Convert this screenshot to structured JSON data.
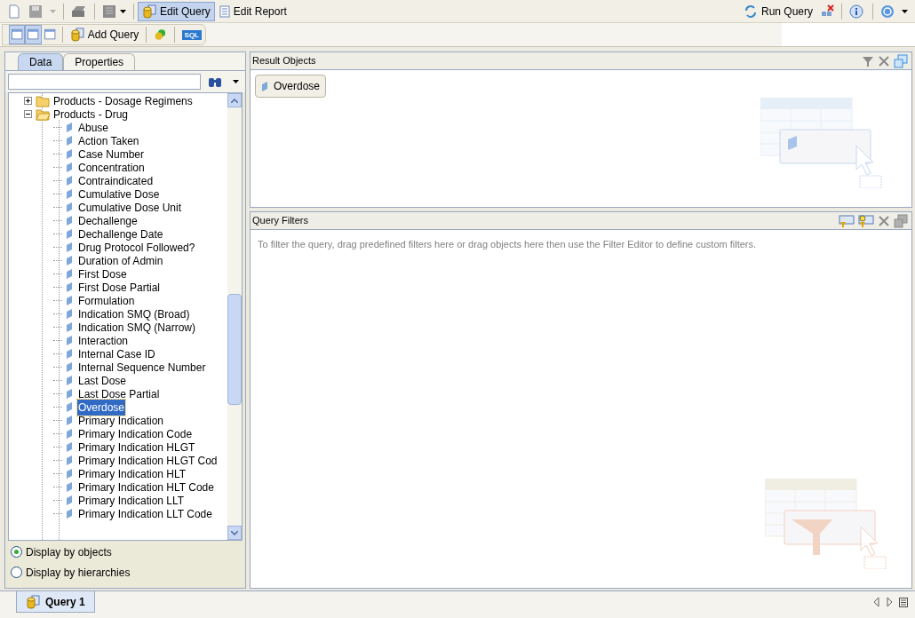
{
  "toolbar": {
    "buttons": [
      {
        "label": "Edit Query",
        "selected": true
      },
      {
        "label": "Edit Report",
        "selected": false
      }
    ],
    "run_query": "Run Query"
  },
  "query_toolbar": {
    "views": [
      {
        "selected": true
      },
      {
        "selected": true
      },
      {
        "selected": false
      }
    ],
    "add_query": "Add Query",
    "sql": "SQL"
  },
  "left_panel": {
    "tabs": [
      {
        "label": "Data",
        "selected": true
      },
      {
        "label": "Properties",
        "selected": false
      }
    ],
    "tree": [
      {
        "label": "Products - Dosage Regimens",
        "expanded": false
      },
      {
        "label": "Products - Drug",
        "expanded": true,
        "children": [
          {
            "label": "Abuse",
            "selected": false
          },
          {
            "label": "Action Taken",
            "selected": false
          },
          {
            "label": "Case Number",
            "selected": false
          },
          {
            "label": "Concentration",
            "selected": false
          },
          {
            "label": "Contraindicated",
            "selected": false
          },
          {
            "label": "Cumulative Dose",
            "selected": false
          },
          {
            "label": "Cumulative Dose Unit",
            "selected": false
          },
          {
            "label": "Dechallenge",
            "selected": false
          },
          {
            "label": "Dechallenge Date",
            "selected": false
          },
          {
            "label": "Drug Protocol Followed?",
            "selected": false
          },
          {
            "label": "Duration of Admin",
            "selected": false
          },
          {
            "label": "First Dose",
            "selected": false
          },
          {
            "label": "First Dose Partial",
            "selected": false
          },
          {
            "label": "Formulation",
            "selected": false
          },
          {
            "label": "Indication SMQ (Broad)",
            "selected": false
          },
          {
            "label": "Indication SMQ (Narrow)",
            "selected": false
          },
          {
            "label": "Interaction",
            "selected": false
          },
          {
            "label": "Internal Case ID",
            "selected": false
          },
          {
            "label": "Internal Sequence Number",
            "selected": false
          },
          {
            "label": "Last Dose",
            "selected": false
          },
          {
            "label": "Last Dose Partial",
            "selected": false
          },
          {
            "label": "Overdose",
            "selected": true
          },
          {
            "label": "Primary Indication",
            "selected": false
          },
          {
            "label": "Primary Indication Code",
            "selected": false
          },
          {
            "label": "Primary Indication HLGT",
            "selected": false
          },
          {
            "label": "Primary Indication HLGT Cod",
            "selected": false
          },
          {
            "label": "Primary Indication HLT",
            "selected": false
          },
          {
            "label": "Primary Indication HLT Code",
            "selected": false
          },
          {
            "label": "Primary Indication LLT",
            "selected": false
          },
          {
            "label": "Primary Indication LLT Code",
            "selected": false
          }
        ]
      }
    ],
    "display_options": [
      {
        "label": "Display by objects",
        "selected": true
      },
      {
        "label": "Display by hierarchies",
        "selected": false
      }
    ]
  },
  "result_objects": {
    "title": "Result Objects",
    "items": [
      {
        "label": "Overdose"
      }
    ]
  },
  "query_filters": {
    "title": "Query Filters",
    "hint": "To filter the query, drag predefined filters here or drag objects here then use the Filter Editor to define custom filters."
  },
  "query_tabs": [
    {
      "label": "Query 1",
      "selected": true
    }
  ]
}
